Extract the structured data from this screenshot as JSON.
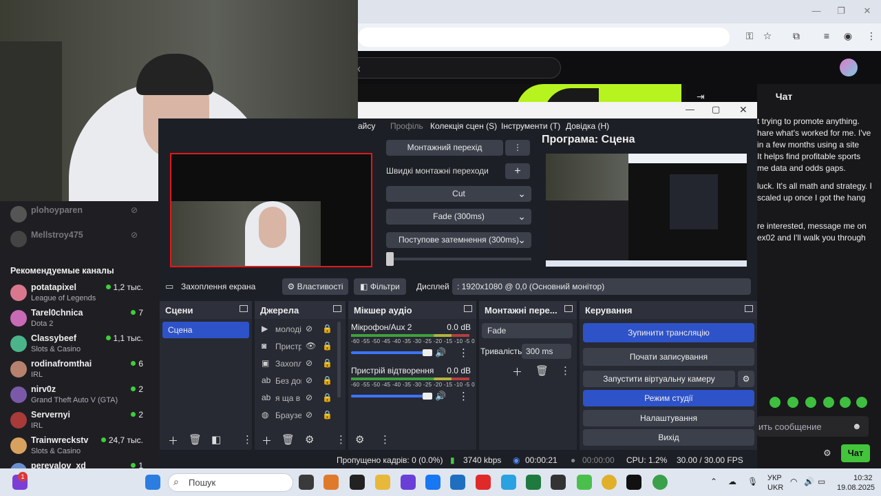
{
  "twitch": {
    "search_placeholder": "ск",
    "chat_title": "Чат",
    "chat_messages": [
      "t trying to promote anything.",
      "hare what's worked for me. I've",
      "in a few months using a site",
      "It helps find profitable sports",
      "me data and odds gaps.",
      "luck. It's all math and strategy. I",
      "scaled up once I got the hang",
      "re interested, message me on",
      "ex02 and I'll walk you through"
    ],
    "chat_input_placeholder": "ить сообщение",
    "chat_send_label": "Чат",
    "offline_channels": [
      "plohoyparen",
      "Mellstroy475"
    ],
    "recommended_title": "Рекомендуемые каналы",
    "recommended": [
      {
        "name": "potatapixel",
        "game": "League of Legends",
        "viewers": "1,2 тыс.",
        "color": "#d9778f"
      },
      {
        "name": "Tarel0chnica",
        "game": "Dota 2",
        "viewers": "7",
        "color": "#c96ab5"
      },
      {
        "name": "Classybeef",
        "game": "Slots & Casino",
        "viewers": "1,1 тыс.",
        "color": "#4bb48a"
      },
      {
        "name": "rodinafromthai",
        "game": "IRL",
        "viewers": "6",
        "color": "#b7826d"
      },
      {
        "name": "nirv0z",
        "game": "Grand Theft Auto V (GTA)",
        "viewers": "2",
        "color": "#7a5aa8"
      },
      {
        "name": "Servernyi",
        "game": "IRL",
        "viewers": "2",
        "color": "#a83a3a"
      },
      {
        "name": "Trainwreckstv",
        "game": "Slots & Casino",
        "viewers": "24,7 тыс.",
        "color": "#d8a25e"
      },
      {
        "name": "perevalov_xd",
        "game": "",
        "viewers": "1",
        "color": "#6a8fd0"
      }
    ]
  },
  "obs": {
    "menu": [
      "айсу",
      "Профіль",
      "Колекція сцен (S)",
      "Інструменти (T)",
      "Довідка (H)"
    ],
    "transition_btn": "Монтажний перехід",
    "quick_transitions": "Швидкі монтажні переходи",
    "dropdowns": [
      "Cut",
      "Fade (300ms)",
      "Поступове затемнення (300ms)"
    ],
    "program_label": "Програма: Сцена",
    "source_name": "Захоплення екрана",
    "properties_btn": "Властивості",
    "filters_btn": "Фільтри",
    "display_label": "Дисплей",
    "display_value": ": 1920x1080 @ 0,0 (Основний монітор)",
    "docks": {
      "scenes": "Сцени",
      "sources": "Джерела",
      "mixer": "Мікшер аудіо",
      "transitions": "Монтажні пере...",
      "controls": "Керування"
    },
    "scene_items": [
      "Сцена"
    ],
    "sources": [
      {
        "icon": "play-icon",
        "name": "молоді"
      },
      {
        "icon": "camera-icon",
        "name": "Пристр"
      },
      {
        "icon": "window-icon",
        "name": "Захопл"
      },
      {
        "icon": "text-icon",
        "name": "Без дон"
      },
      {
        "icon": "text-icon",
        "name": "я ща в"
      },
      {
        "icon": "globe-icon",
        "name": "Браузе"
      }
    ],
    "mixer": [
      {
        "name": "Мікрофон/Aux 2",
        "db": "0.0 dB"
      },
      {
        "name": "Пристрій відтворення",
        "db": "0.0 dB"
      }
    ],
    "mixer_scale": "-60 -55 -50 -45 -40 -35 -30 -25 -20 -15 -10 -5 0",
    "transition_select": "Fade",
    "duration_label": "Тривалість",
    "duration_value": "300 ms",
    "controls": [
      {
        "label": "Зупинити трансляцію",
        "active": true
      },
      {
        "label": "Почати записування",
        "active": false
      },
      {
        "label": "Запустити віртуальну камеру",
        "active": false
      },
      {
        "label": "Режим студії",
        "active": true
      },
      {
        "label": "Налаштування",
        "active": false
      },
      {
        "label": "Вихід",
        "active": false
      }
    ],
    "status": {
      "dropped": "Пропущено кадрів: 0 (0.0%)",
      "bitrate": "3740 kbps",
      "stream_time": "00:00:21",
      "rec_time": "00:00:00",
      "cpu": "CPU: 1.2%",
      "fps": "30.00 / 30.00 FPS"
    }
  },
  "taskbar": {
    "search": "Пошук",
    "lang1": "УКР",
    "lang2": "UKR",
    "time": "10:32",
    "date": "19.08.2025",
    "badge": "1"
  }
}
